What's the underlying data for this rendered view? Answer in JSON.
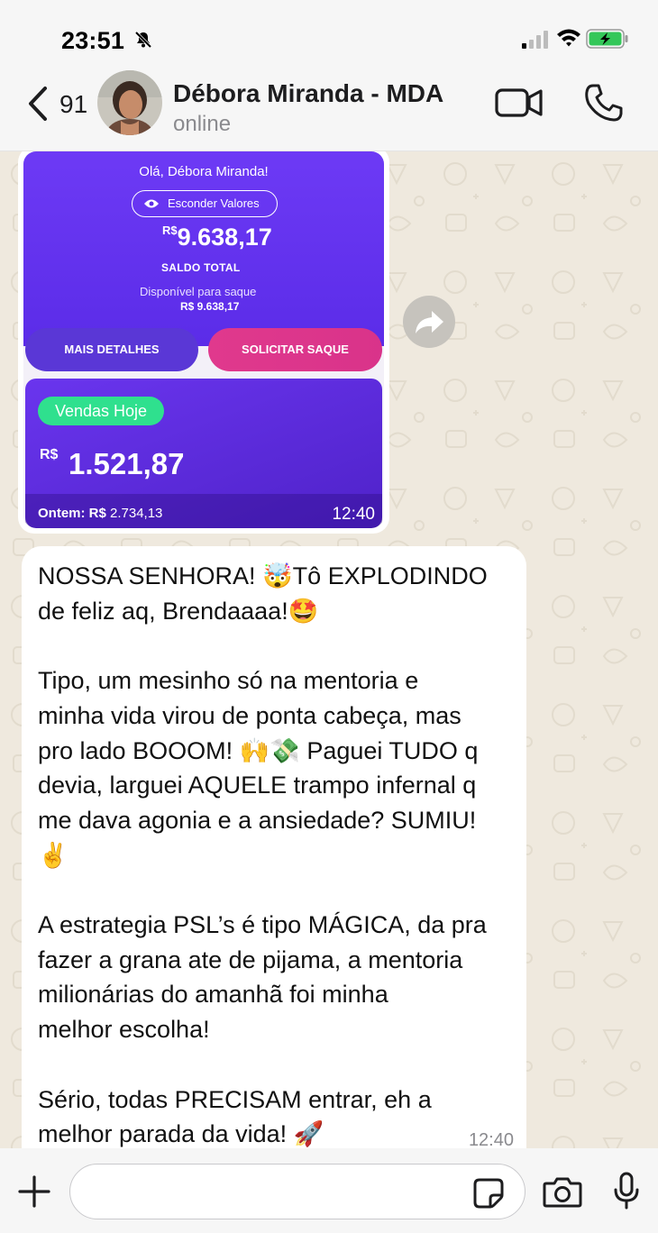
{
  "status_bar": {
    "time": "23:51"
  },
  "header": {
    "back_count": "91",
    "contact_name": "Débora Miranda - MDA",
    "contact_status": "online"
  },
  "image_message": {
    "greeting": "Olá, Débora Miranda!",
    "hide_values": "Esconder Valores",
    "currency": "R$",
    "balance": "9.638,17",
    "saldo_total": "SALDO TOTAL",
    "available_label": "Disponível para saque",
    "available_value": "R$ 9.638,17",
    "btn_details": "MAIS DETALHES",
    "btn_withdraw": "SOLICITAR SAQUE",
    "sales_today_label": "Vendas Hoje",
    "sales_currency": "R$",
    "sales_today_value": "1.521,87",
    "yesterday_label": "Ontem: R$",
    "yesterday_value": "2.734,13",
    "time": "12:40"
  },
  "text_message": {
    "body": "NOSSA SENHORA! 🤯Tô EXPLODINDO\nde feliz aq, Brendaaaa!🤩\n\nTipo, um mesinho só na mentoria e\nminha vida virou de ponta cabeça, mas\npro lado BOOOM! 🙌💸 Paguei TUDO q\ndevia, larguei AQUELE trampo infernal q\nme dava agonia e a ansiedade? SUMIU!\n✌️\n\nA estrategia PSL’s é tipo MÁGICA, da pra\nfazer a grana ate de pijama, a mentoria\nmilionárias do amanhã foi minha\nmelhor escolha!\n\nSério, todas PRECISAM entrar, eh a\nmelhor parada da vida! 🚀",
    "time": "12:40"
  },
  "composer": {
    "placeholder": ""
  },
  "colors": {
    "card_purple": "#6d3af5",
    "withdraw_pink": "#e0398d",
    "sales_green": "#2fe08e",
    "chat_bg": "#efe9de",
    "battery_green": "#34c759"
  }
}
